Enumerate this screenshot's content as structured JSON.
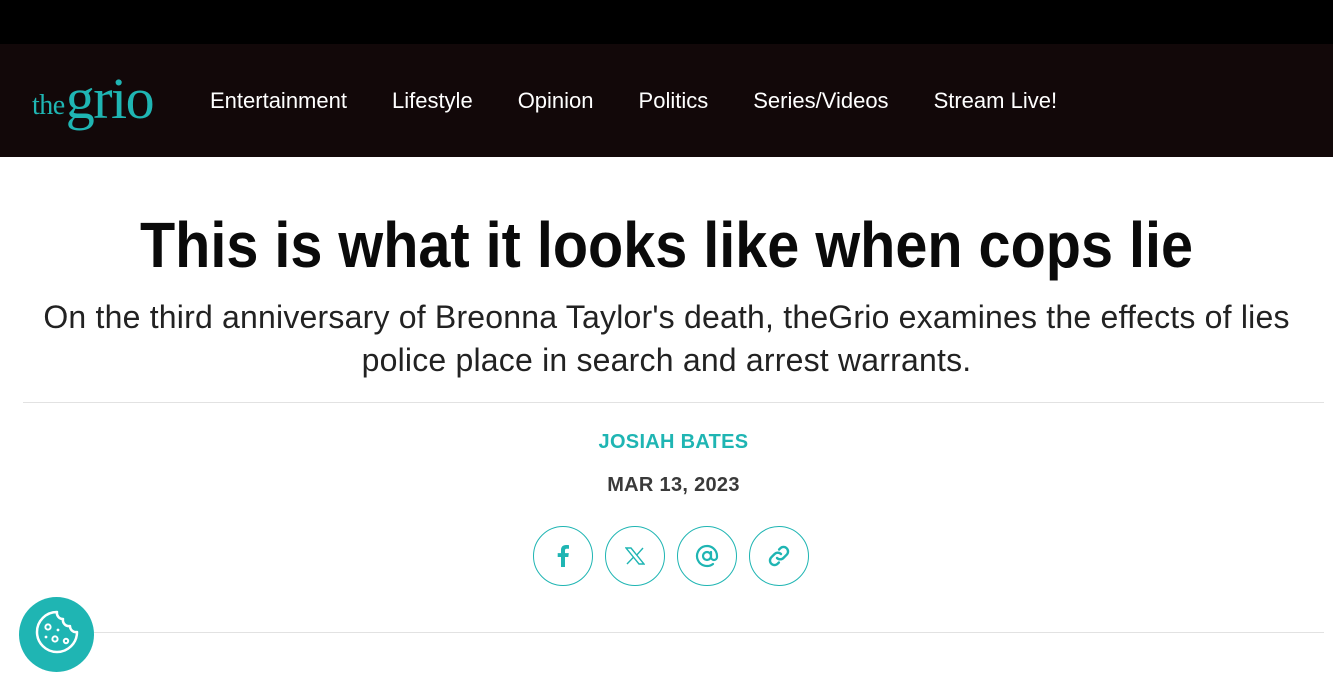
{
  "site": {
    "logo_the": "the",
    "logo_grio": "grio",
    "brand_color": "#1fb5b3",
    "nav_background": "#120809"
  },
  "nav": {
    "items": [
      {
        "label": "Entertainment"
      },
      {
        "label": "Lifestyle"
      },
      {
        "label": "Opinion"
      },
      {
        "label": "Politics"
      },
      {
        "label": "Series/Videos"
      },
      {
        "label": "Stream Live!"
      }
    ]
  },
  "article": {
    "headline": "This is what it looks like when cops lie",
    "subheadline": "On the third anniversary of Breonna Taylor's death, theGrio examines the effects of lies police place in search and arrest warrants.",
    "author": "JOSIAH BATES",
    "date": "MAR 13, 2023"
  },
  "share": {
    "buttons": [
      {
        "icon": "facebook-icon",
        "glyph": "f"
      },
      {
        "icon": "x-icon",
        "glyph": "𝕏"
      },
      {
        "icon": "at-sign-icon",
        "glyph": "@"
      },
      {
        "icon": "link-icon"
      }
    ]
  },
  "cookie": {
    "icon": "cookie-icon"
  }
}
